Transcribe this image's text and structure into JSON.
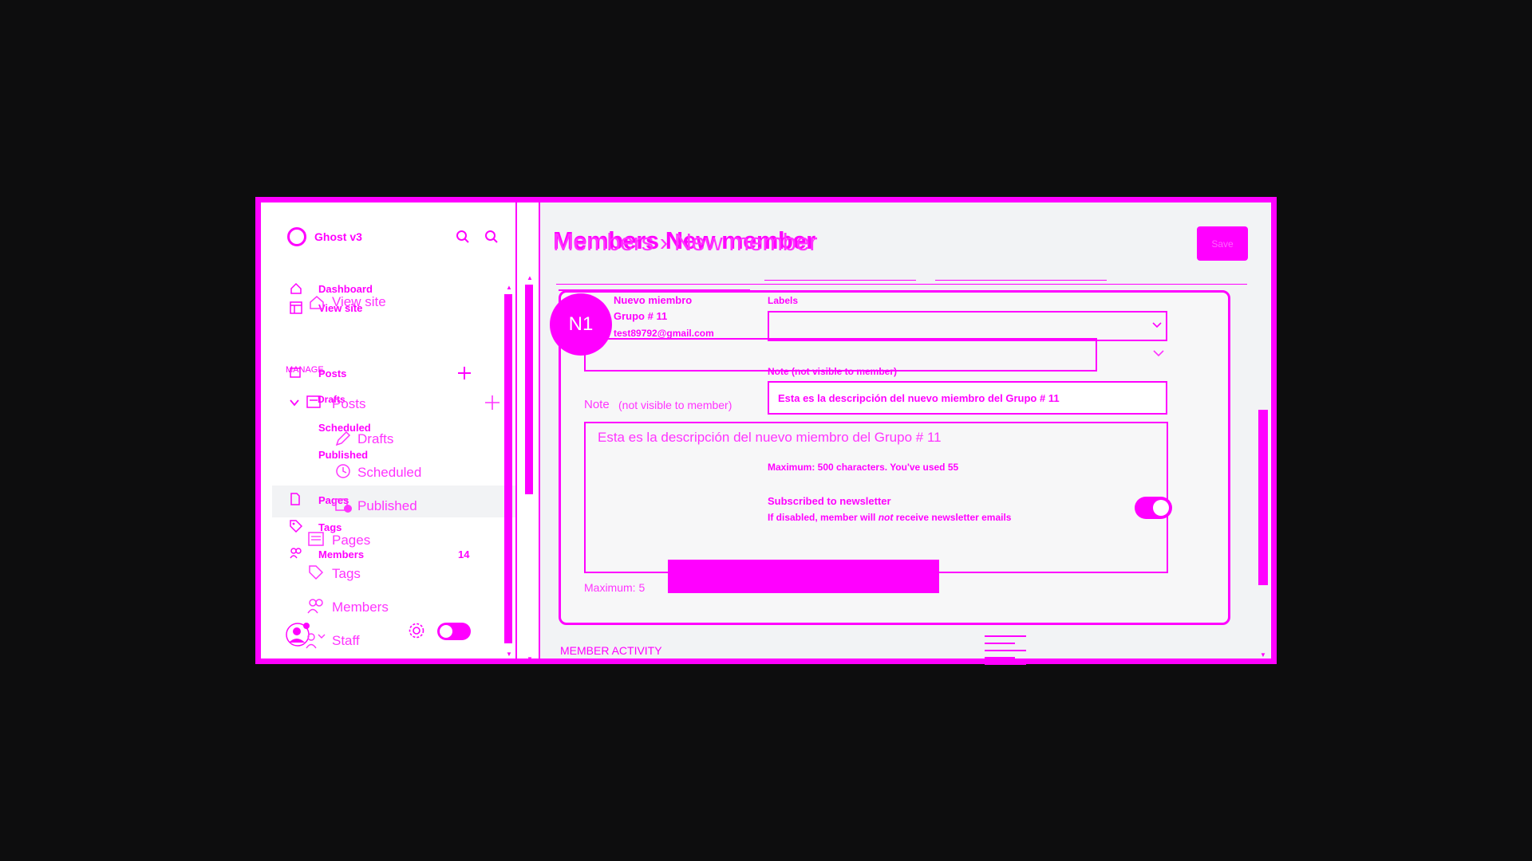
{
  "sidebar": {
    "site_name": "Ghost v3",
    "nav_primary": [
      {
        "label": "Dashboard",
        "icon": "home-icon"
      },
      {
        "label": "View site",
        "icon": "layout-icon"
      }
    ],
    "ghost_view_site": "View site",
    "section_manage": "MANAGE",
    "posts_label": "Posts",
    "posts_ghost": "Posts",
    "drafts_label": "Drafts",
    "drafts_ghost": "Drafts",
    "scheduled_label": "Scheduled",
    "scheduled_ghost": "Scheduled",
    "published_label": "Published",
    "published_ghost": "Published",
    "pages_label": "Pages",
    "pages_ghost": "Pages",
    "tags_label": "Tags",
    "tags_ghost": "Tags",
    "members_label": "Members",
    "members_ghost": "Members",
    "members_count": "14",
    "staff_ghost": "Staff"
  },
  "header": {
    "breadcrumb_bold": "Members   New member",
    "breadcrumb_ghost": "Members › New member",
    "save_label": "Save"
  },
  "member": {
    "avatar_initials": "N1",
    "name_line1": "Nuevo miembro",
    "name_line2": "Grupo # 11",
    "email": "test89792@gmail.com"
  },
  "form": {
    "labels_label": "Labels",
    "note_label": "Note (not visible to member)",
    "note_label_ghost": "Note",
    "note_label_ghost_hint": "(not visible to member)",
    "note_value": "Esta es la descripción del nuevo miembro del Grupo # 11",
    "note_counter": "Maximum: 500 characters. You've used 55",
    "note_counter_ghost": "Maximum: 5",
    "newsletter_label": "Subscribed to newsletter",
    "newsletter_hint_pre": "If disabled, member will",
    "newsletter_hint_em": "not",
    "newsletter_hint_post": "receive newsletter emails",
    "member_activity": "MEMBER ACTIVITY"
  },
  "colors": {
    "accent": "#ff00ff",
    "background": "#0d0d0e"
  }
}
